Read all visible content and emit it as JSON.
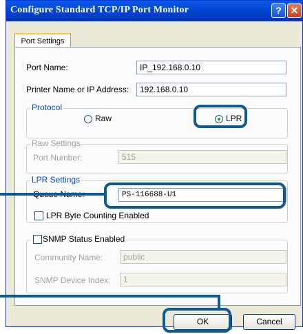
{
  "window": {
    "title": "Configure Standard TCP/IP Port Monitor",
    "help_glyph": "?",
    "close_glyph": "✕"
  },
  "tabs": {
    "port_settings": "Port Settings"
  },
  "port_name": {
    "label": "Port Name:",
    "value": "IP_192.168.0.10"
  },
  "printer_name": {
    "label": "Printer Name or IP Address:",
    "value": "192.168.0.10"
  },
  "protocol": {
    "legend": "Protocol",
    "raw_label": "Raw",
    "lpr_label": "LPR",
    "selected": "LPR"
  },
  "raw_settings": {
    "legend": "Raw Settings",
    "port_number_label": "Port Number:",
    "port_number_value": "515"
  },
  "lpr_settings": {
    "legend": "LPR Settings",
    "queue_name_label": "Queue Name:",
    "queue_name_value": "PS-116688-U1",
    "byte_counting_label": "LPR Byte Counting Enabled"
  },
  "snmp": {
    "status_label": "SNMP Status Enabled",
    "community_label": "Community Name:",
    "community_value": "public",
    "device_index_label": "SNMP Device Index:",
    "device_index_value": "1"
  },
  "buttons": {
    "ok": "OK",
    "cancel": "Cancel"
  },
  "highlight_color": "#0e5a8f"
}
